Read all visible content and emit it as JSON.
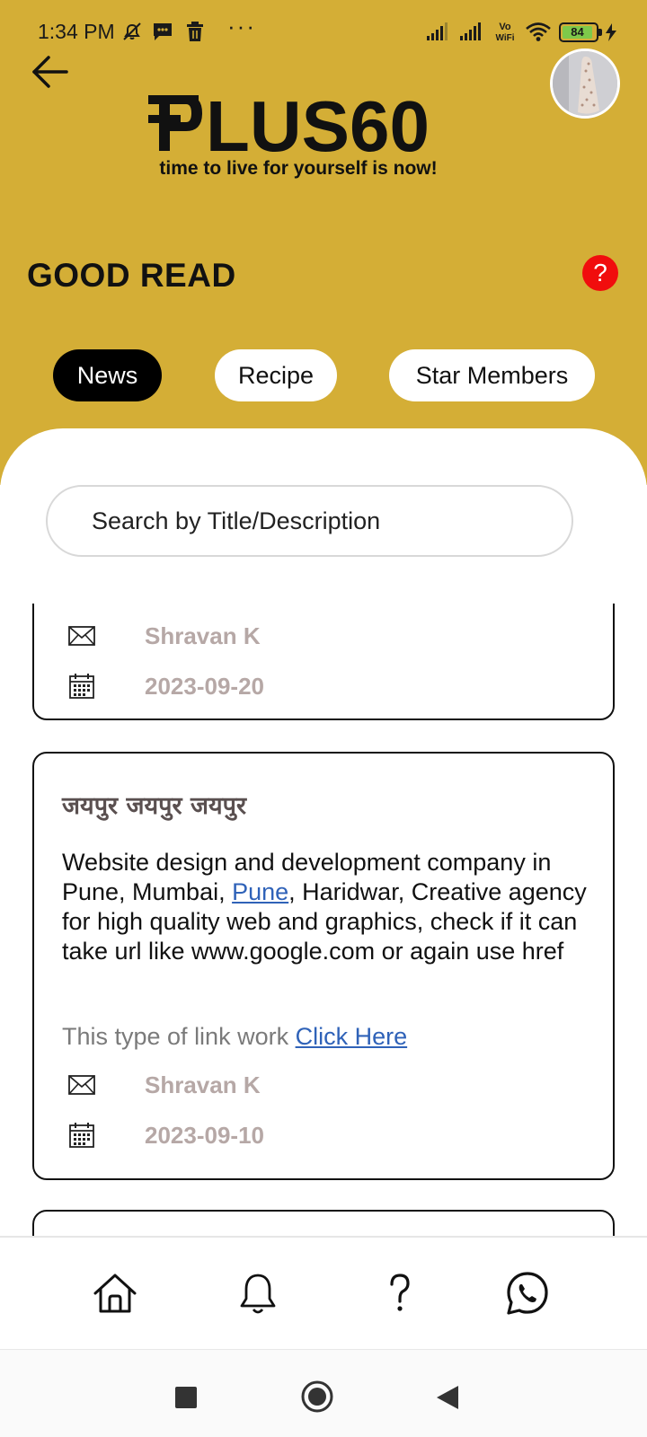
{
  "status_bar": {
    "time": "1:34 PM",
    "battery": "84",
    "icons": [
      "mute-notification-icon",
      "message-icon",
      "trash-icon",
      "more-dots-icon",
      "signal-icon",
      "signal-icon",
      "vowifi-icon",
      "wifi-icon",
      "battery-icon",
      "charging-icon"
    ],
    "vowifi_label": "Vo WiFi"
  },
  "header": {
    "back_icon": "arrow-left-icon",
    "logo_text": "PLUS60",
    "tagline": "time to live for yourself is now!",
    "avatar": "profile-avatar"
  },
  "section": {
    "title": "GOOD READ",
    "help_label": "?"
  },
  "tabs": [
    {
      "label": "News",
      "active": true
    },
    {
      "label": "Recipe",
      "active": false
    },
    {
      "label": "Star Members",
      "active": false
    }
  ],
  "search": {
    "placeholder": "Search by Title/Description"
  },
  "posts": [
    {
      "author": "Shravan K",
      "date": "2023-09-20"
    },
    {
      "title": "जयपुर जयपुर जयपुर",
      "desc_part1": "Website design and development company in Pune, Mumbai, ",
      "desc_link": "Pune",
      "desc_part2": ", Haridwar, Creative agency for high quality web and graphics, check if it can take url like www.google.com or again use href",
      "note_text": "This type of link work ",
      "note_link": "Click Here",
      "author": "Shravan K",
      "date": "2023-09-10"
    }
  ],
  "bottom_nav": [
    "home-icon",
    "bell-icon",
    "help-icon",
    "whatsapp-icon"
  ],
  "system_nav": [
    "recents-button",
    "home-button",
    "back-button"
  ],
  "colors": {
    "header_bg": "#d4ae36",
    "active_tab": "#000000",
    "help_badge": "#f10d0d",
    "link": "#2f62b8",
    "meta_text": "#b6a8a6"
  }
}
